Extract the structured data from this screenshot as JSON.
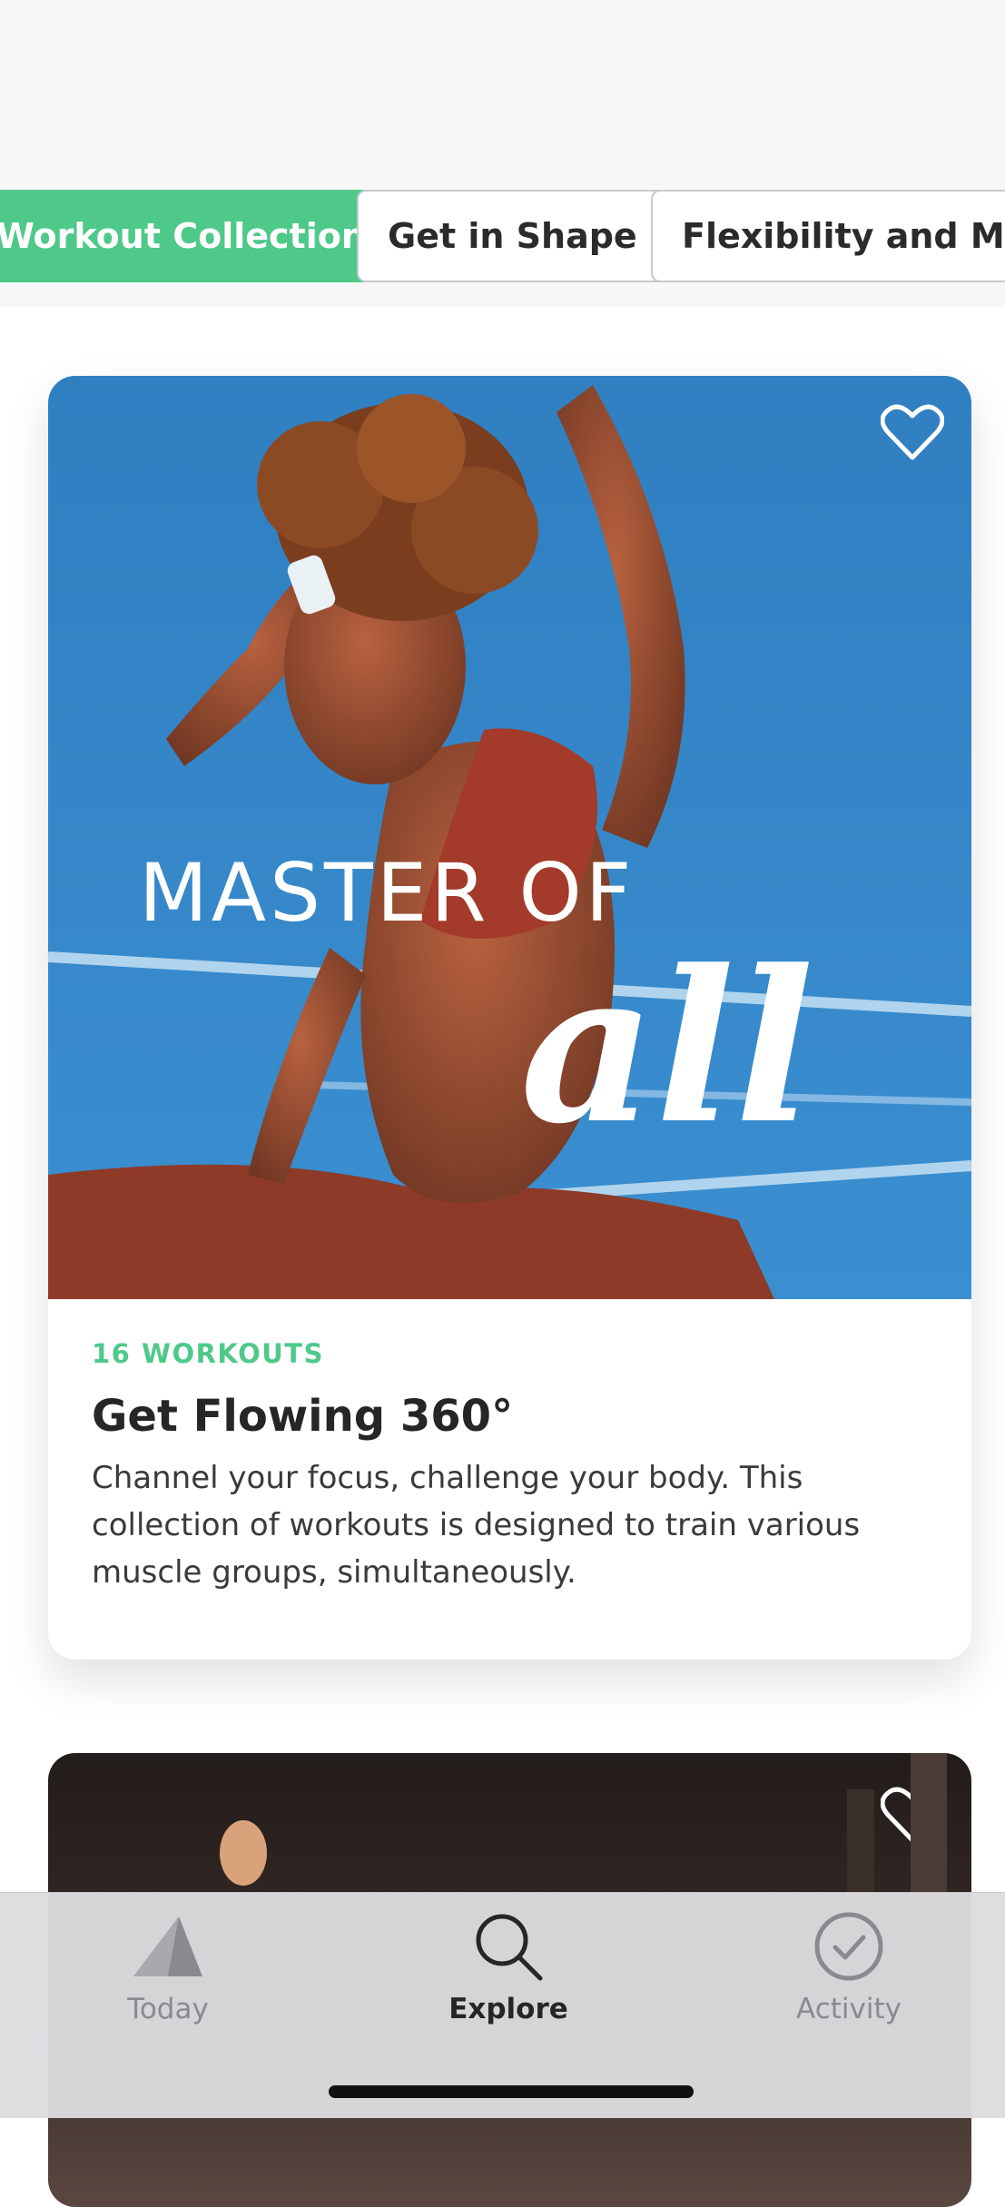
{
  "chips": [
    {
      "label": "Workout Collections",
      "active": true
    },
    {
      "label": "Get in Shape",
      "active": false
    },
    {
      "label": "Flexibility and Mobility",
      "active": false
    }
  ],
  "card": {
    "image_text": {
      "line1": "MASTER OF",
      "line2": "all"
    },
    "count": "16 WORKOUTS",
    "title": "Get Flowing 360°",
    "description": "Channel your focus, challenge your body. This collection of workouts is designed to train various muscle groups, simultaneously."
  },
  "tabs": [
    {
      "label": "Today",
      "icon": "today-icon",
      "active": false
    },
    {
      "label": "Explore",
      "icon": "search-icon",
      "active": true
    },
    {
      "label": "Activity",
      "icon": "check-circle-icon",
      "active": false
    }
  ],
  "colors": {
    "accent": "#4ec98a",
    "text": "#262626"
  }
}
